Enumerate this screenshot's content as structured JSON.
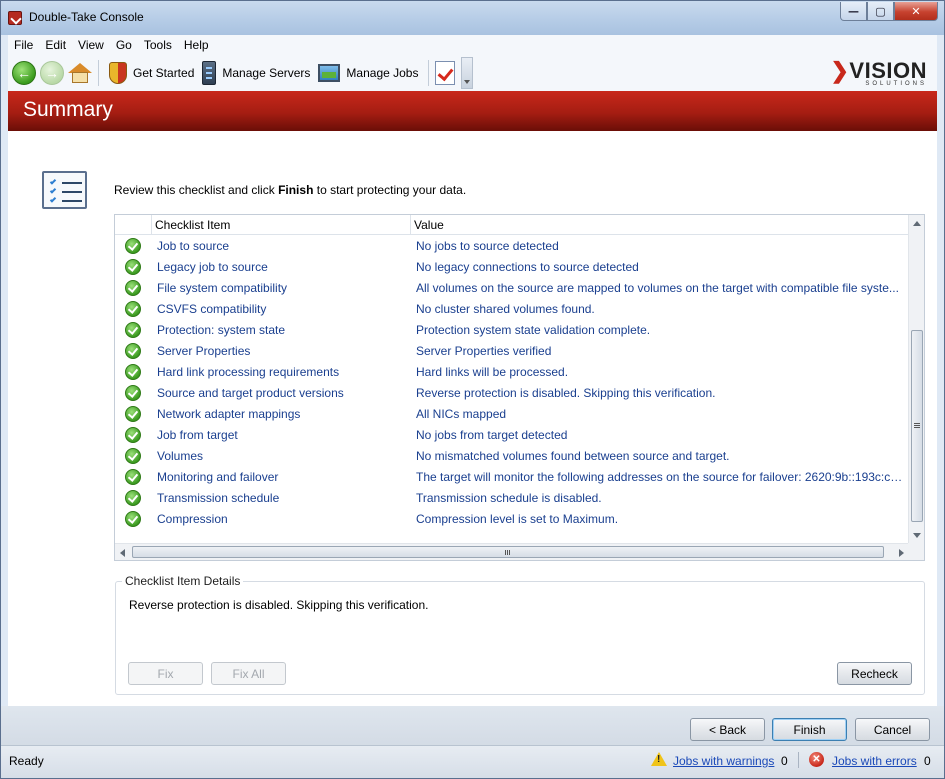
{
  "window": {
    "title": "Double-Take Console",
    "controls": {
      "minimize": "—",
      "maximize": "▢",
      "close": "✕"
    }
  },
  "menu": [
    "File",
    "Edit",
    "View",
    "Go",
    "Tools",
    "Help"
  ],
  "toolbar": {
    "back_icon": "back-arrow-icon",
    "forward_icon": "forward-arrow-icon",
    "home_icon": "home-icon",
    "get_started": "Get Started",
    "manage_servers": "Manage Servers",
    "manage_jobs": "Manage Jobs",
    "brand": "VISION",
    "brand_sub": "SOLUTIONS"
  },
  "banner": {
    "title": "Summary",
    "color": "#b52216"
  },
  "page": {
    "instruction_pre": "Review this checklist and click ",
    "instruction_bold": "Finish",
    "instruction_post": " to start protecting your data."
  },
  "grid": {
    "columns": [
      "Checklist Item",
      "Value"
    ],
    "rows": [
      {
        "item": "Job to source",
        "value": "No jobs to source detected",
        "status": "ok"
      },
      {
        "item": "Legacy job to source",
        "value": "No legacy connections to source detected",
        "status": "ok"
      },
      {
        "item": "File system compatibility",
        "value": "All volumes on the source are mapped to volumes on the target with compatible file syste...",
        "status": "ok"
      },
      {
        "item": "CSVFS compatibility",
        "value": "No cluster shared volumes found.",
        "status": "ok"
      },
      {
        "item": "Protection: system state",
        "value": "Protection system state validation complete.",
        "status": "ok"
      },
      {
        "item": "Server Properties",
        "value": "Server Properties verified",
        "status": "ok"
      },
      {
        "item": "Hard link processing requirements",
        "value": "Hard links will be processed.",
        "status": "ok"
      },
      {
        "item": "Source and target product versions",
        "value": "Reverse protection is disabled.  Skipping this verification.",
        "status": "ok"
      },
      {
        "item": "Network adapter mappings",
        "value": "All NICs mapped",
        "status": "ok"
      },
      {
        "item": "Job from target",
        "value": "No jobs from target detected",
        "status": "ok"
      },
      {
        "item": "Volumes",
        "value": "No mismatched volumes found between source and target.",
        "status": "ok"
      },
      {
        "item": "Monitoring and failover",
        "value": "The target will monitor the following addresses on the source for failover: 2620:9b::193c:c7...",
        "status": "ok"
      },
      {
        "item": "Transmission schedule",
        "value": "Transmission schedule is disabled.",
        "status": "ok"
      },
      {
        "item": "Compression",
        "value": "Compression level is set to Maximum.",
        "status": "ok"
      }
    ],
    "hscroll_grip": "III"
  },
  "details": {
    "title": "Checklist Item Details",
    "text": "Reverse protection is disabled.  Skipping this verification.",
    "fix": "Fix",
    "fix_all": "Fix All",
    "recheck": "Recheck"
  },
  "nav": {
    "back": "< Back",
    "finish": "Finish",
    "cancel": "Cancel"
  },
  "status": {
    "ready": "Ready",
    "warnings_label": "Jobs with warnings",
    "warnings_count": "0",
    "errors_label": "Jobs with errors",
    "errors_count": "0"
  }
}
